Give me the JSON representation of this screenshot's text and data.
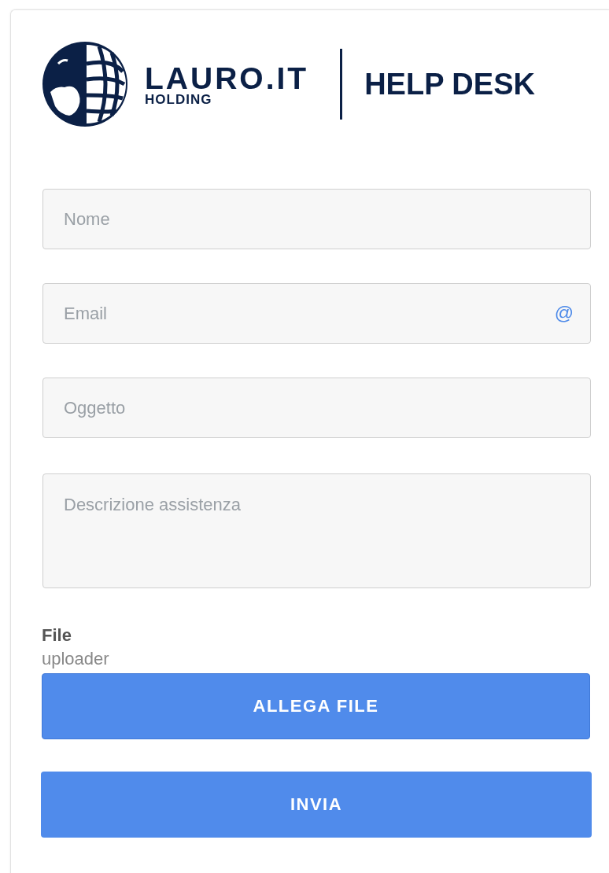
{
  "header": {
    "brand": "LAURO.IT",
    "brand_sub": "HOLDING",
    "title": "HELP DESK"
  },
  "fields": [
    {
      "kind": "text",
      "placeholder": "Nome"
    },
    {
      "kind": "email",
      "placeholder": "Email",
      "icon_text": "@"
    },
    {
      "kind": "text",
      "placeholder": "Oggetto"
    },
    {
      "kind": "textarea",
      "placeholder": "Descrizione assistenza"
    }
  ],
  "file": {
    "label": "File",
    "hint": "uploader",
    "button": "ALLEGA FILE"
  },
  "submit": "INVIA"
}
